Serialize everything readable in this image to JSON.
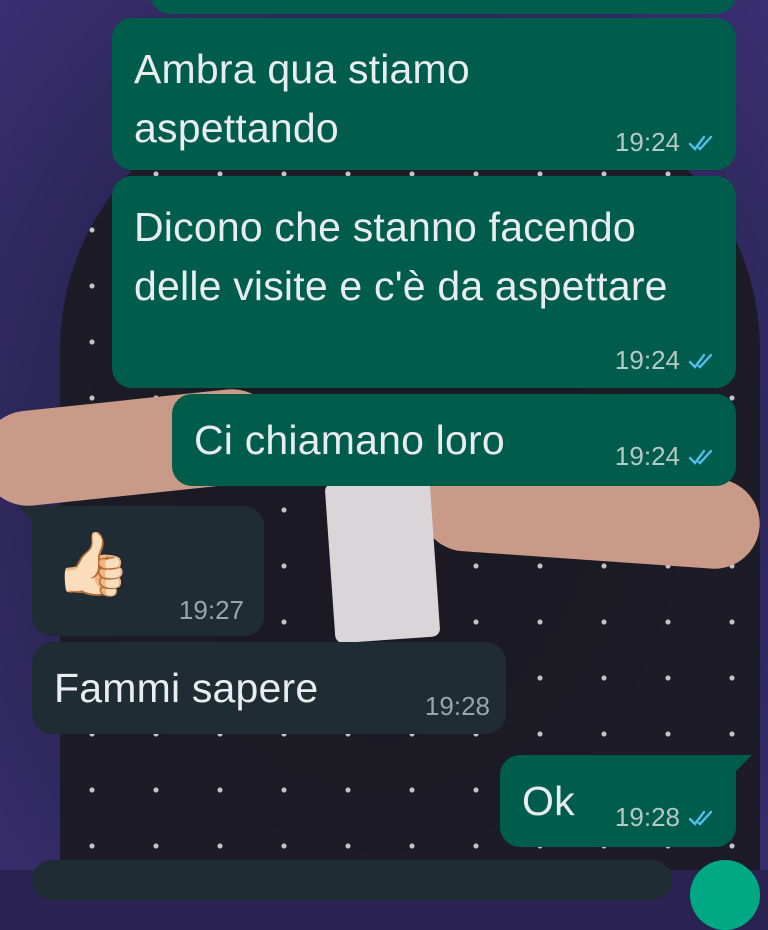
{
  "messages": [
    {
      "direction": "out",
      "text": "Ambra qua stiamo aspettando",
      "time": "19:24",
      "status": "read"
    },
    {
      "direction": "out",
      "text": "Dicono che stanno facendo delle visite e c'è da aspettare",
      "time": "19:24",
      "status": "read"
    },
    {
      "direction": "out",
      "text": "Ci chiamano loro",
      "time": "19:24",
      "status": "read"
    },
    {
      "direction": "in",
      "emoji": "👍🏻",
      "time": "19:27"
    },
    {
      "direction": "in",
      "text": "Fammi sapere",
      "time": "19:28"
    },
    {
      "direction": "out",
      "text": "Ok",
      "time": "19:28",
      "status": "read"
    }
  ],
  "icons": {
    "read_receipt": "double-check-icon"
  },
  "colors": {
    "outgoing_bubble": "#005c4b",
    "incoming_bubble": "#202c33",
    "text": "#e9edef",
    "read_ticks": "#53bdeb"
  }
}
